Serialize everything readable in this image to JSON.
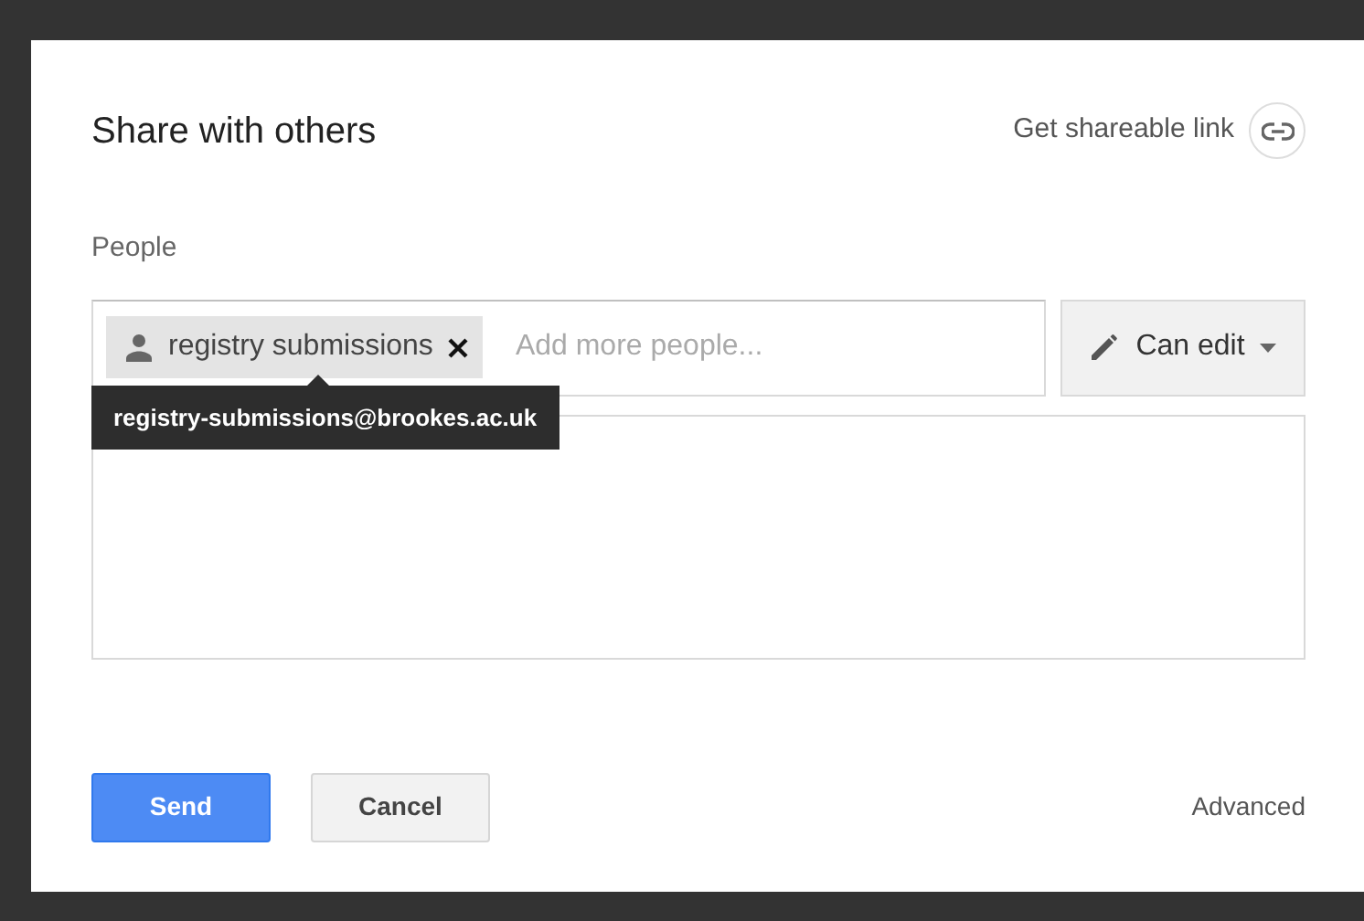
{
  "dialog": {
    "title": "Share with others",
    "link_label": "Get shareable link"
  },
  "people": {
    "label": "People",
    "chips": [
      {
        "name": "registry submissions",
        "tooltip": "registry-submissions@brookes.ac.uk"
      }
    ],
    "placeholder": "Add more people...",
    "permission": "Can edit"
  },
  "buttons": [
    {
      "label": "Send",
      "kind": "primary"
    },
    {
      "label": "Cancel",
      "kind": "secondary"
    }
  ],
  "advanced": "Advanced"
}
